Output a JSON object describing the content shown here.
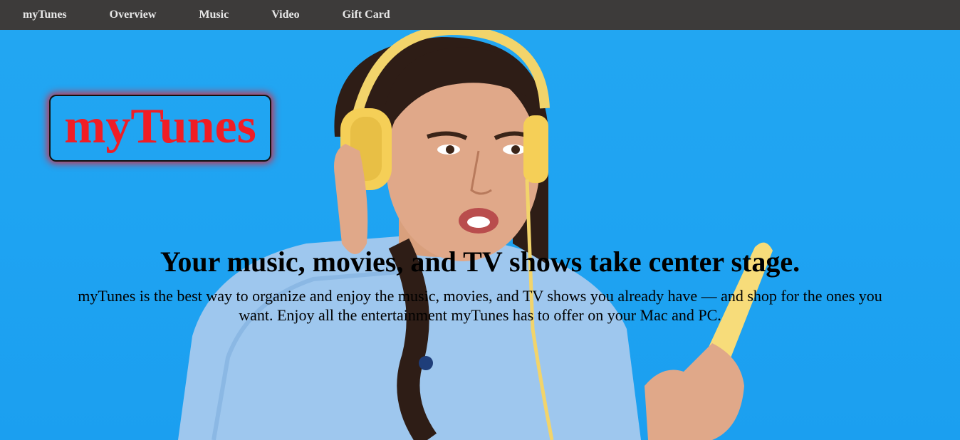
{
  "nav": {
    "items": [
      {
        "label": "myTunes"
      },
      {
        "label": "Overview"
      },
      {
        "label": "Music"
      },
      {
        "label": "Video"
      },
      {
        "label": "Gift Card"
      }
    ]
  },
  "hero": {
    "logo_text": "myTunes",
    "headline": "Your music, movies, and TV shows take center stage.",
    "description": "myTunes is the best way to organize and enjoy the music, movies, and TV shows you already have — and shop for the ones you want. Enjoy all the entertainment myTunes has to offer on your Mac and PC.",
    "background_color": "#1fa4f2",
    "logo_color": "#f01d25"
  }
}
